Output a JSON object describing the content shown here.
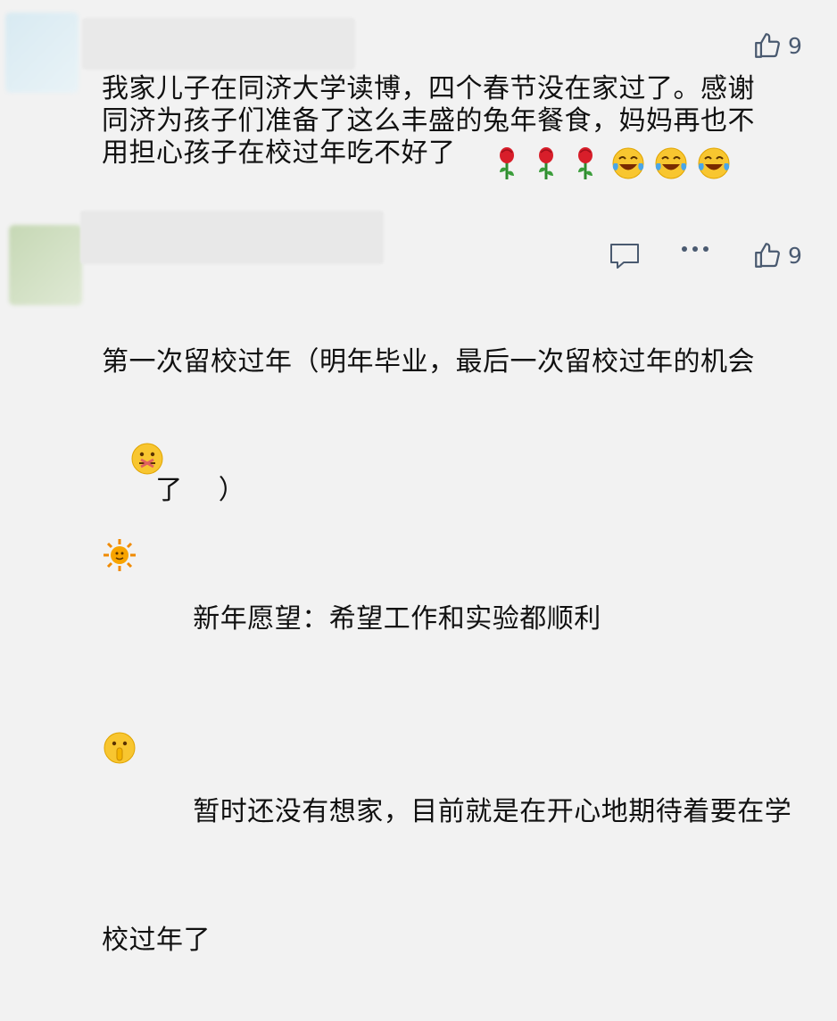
{
  "comments": [
    {
      "likes": "9",
      "text": "我家儿子在同济大学读博，四个春节没在家过了。感谢\n同济为孩子们准备了这么丰盛的兔年餐食，妈妈再也不\n用担心孩子在校过年吃不好了",
      "emojis": [
        "rose-icon",
        "rose-icon",
        "rose-icon",
        "laughing-tears-icon",
        "laughing-tears-icon",
        "laughing-tears-icon"
      ]
    },
    {
      "likes": "9",
      "line1": "第一次留校过年（明年毕业，最后一次留校过年的机会",
      "line2": "了",
      "line2_end": "）",
      "line3": "新年愿望：希望工作和实验都顺利",
      "line4a": "暂时还没有想家，目前就是在开心地期待着要在学",
      "line4b": "校过年了"
    }
  ],
  "colors": {
    "background": "#f2f2f2",
    "icon": "#4a5a70"
  }
}
